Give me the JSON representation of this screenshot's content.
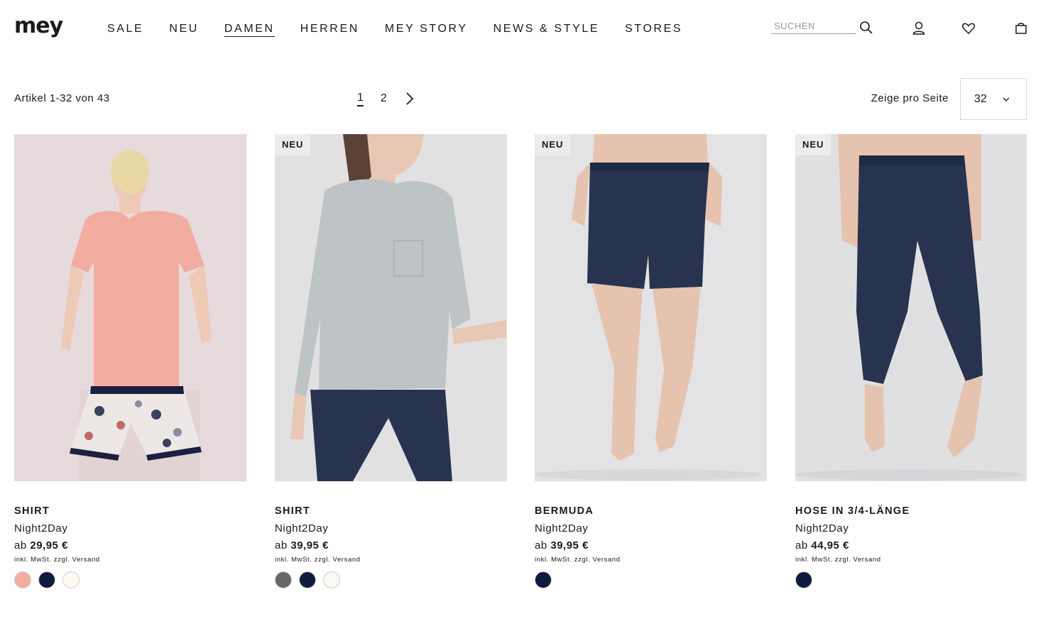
{
  "header": {
    "logo": "mey",
    "nav": [
      "SALE",
      "NEU",
      "DAMEN",
      "HERREN",
      "MEY STORY",
      "NEWS & STYLE",
      "STORES"
    ],
    "search_placeholder": "SUCHEN",
    "icons": [
      "search-icon",
      "user-icon",
      "heart-icon",
      "bag-icon"
    ]
  },
  "toolbar": {
    "count": "Artikel 1-32 von 43",
    "pages": [
      "1",
      "2"
    ],
    "current_page": "1",
    "per_page_label": "Zeige pro Seite",
    "per_page_value": "32"
  },
  "products": [
    {
      "badge": "",
      "title": "SHIRT",
      "subtitle": "Night2Day",
      "price_prefix": "ab",
      "price": "29,95 €",
      "tax": "inkl. MwSt. zzgl. Versand",
      "swatches": [
        "#f2aca0",
        "#0f1b3d",
        "#fbf9f2"
      ]
    },
    {
      "badge": "NEU",
      "title": "SHIRT",
      "subtitle": "Night2Day",
      "price_prefix": "ab",
      "price": "39,95 €",
      "tax": "inkl. MwSt. zzgl. Versand",
      "swatches": [
        "#676767",
        "#0f1b3d",
        "#fbf9f2"
      ]
    },
    {
      "badge": "NEU",
      "title": "BERMUDA",
      "subtitle": "Night2Day",
      "price_prefix": "ab",
      "price": "39,95 €",
      "tax": "inkl. MwSt. zzgl. Versand",
      "swatches": [
        "#0f1b3d"
      ]
    },
    {
      "badge": "NEU",
      "title": "HOSE IN 3/4-LÄNGE",
      "subtitle": "Night2Day",
      "price_prefix": "ab",
      "price": "44,95 €",
      "tax": "inkl. MwSt. zzgl. Versand",
      "swatches": [
        "#0f1b3d"
      ]
    }
  ]
}
